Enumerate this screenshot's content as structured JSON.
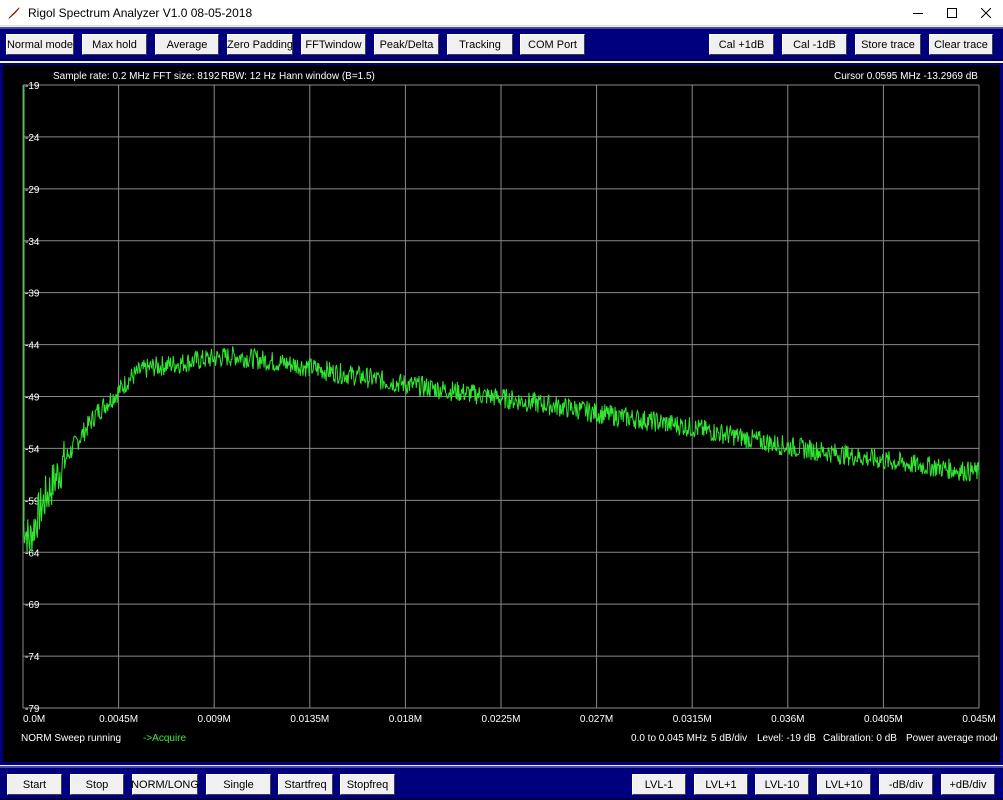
{
  "window": {
    "title": "Rigol Spectrum Analyzer V1.0 08-05-2018",
    "icon": "tk-feather-icon"
  },
  "top_toolbar": {
    "buttons": [
      {
        "label": "Normal mode",
        "name": "normal-mode-button"
      },
      {
        "label": "Max hold",
        "name": "max-hold-button"
      },
      {
        "label": "Average",
        "name": "average-button"
      },
      {
        "label": "Zero Padding",
        "name": "zero-padding-button"
      },
      {
        "label": "FFTwindow",
        "name": "fft-window-button"
      },
      {
        "label": "Peak/Delta",
        "name": "peak-delta-button"
      },
      {
        "label": "Tracking",
        "name": "tracking-button"
      },
      {
        "label": "COM Port",
        "name": "com-port-button"
      },
      {
        "label": "Cal +1dB",
        "name": "cal-plus-1db-button"
      },
      {
        "label": "Cal -1dB",
        "name": "cal-minus-1db-button"
      },
      {
        "label": "Store trace",
        "name": "store-trace-button"
      },
      {
        "label": "Clear trace",
        "name": "clear-trace-button"
      }
    ]
  },
  "bottom_toolbar": {
    "buttons": [
      {
        "label": "Start",
        "name": "start-button"
      },
      {
        "label": "Stop",
        "name": "stop-button"
      },
      {
        "label": "NORM/LONG",
        "name": "norm-long-button"
      },
      {
        "label": "Single",
        "name": "single-button"
      },
      {
        "label": "Startfreq",
        "name": "startfreq-button"
      },
      {
        "label": "Stopfreq",
        "name": "stopfreq-button"
      },
      {
        "label": "LVL-1",
        "name": "lvl-minus-1-button"
      },
      {
        "label": "LVL+1",
        "name": "lvl-plus-1-button"
      },
      {
        "label": "LVL-10",
        "name": "lvl-minus-10-button"
      },
      {
        "label": "LVL+10",
        "name": "lvl-plus-10-button"
      },
      {
        "label": "-dB/div",
        "name": "db-div-minus-button"
      },
      {
        "label": "+dB/div",
        "name": "db-div-plus-button"
      }
    ]
  },
  "plot": {
    "header": {
      "sample_rate": "Sample rate: 0.2 MHz",
      "fft_size": "FFT size: 8192",
      "rbw": "RBW: 12 Hz",
      "window": "Hann window (B=1.5)",
      "cursor": "Cursor 0.0595 MHz   -13.2969 dB"
    },
    "footer": {
      "status": "NORM Sweep running",
      "acquire": "->Acquire",
      "range": "0.0 to 0.045 MHz",
      "db_div": "5 dB/div",
      "level": "Level: -19 dB",
      "calibration": "Calibration: 0 dB",
      "mode": "Power average  mode"
    },
    "colors": {
      "background": "#000000",
      "grid": "#8a8a8a",
      "trace": "#32e632",
      "text": "#ffffff"
    }
  },
  "chart_data": {
    "type": "line",
    "title": "",
    "xlabel": "",
    "ylabel": "",
    "xlim": [
      0,
      0.045
    ],
    "ylim": [
      -79,
      -19
    ],
    "grid": true,
    "x_tick_labels": [
      "0.0M",
      "0.0045M",
      "0.009M",
      "0.0135M",
      "0.018M",
      "0.0225M",
      "0.027M",
      "0.0315M",
      "0.036M",
      "0.0405M",
      "0.045M"
    ],
    "y_tick_labels": [
      "-19",
      "-24",
      "-29",
      "-34",
      "-39",
      "-44",
      "-49",
      "-54",
      "-59",
      "-64",
      "-69",
      "-74",
      "-79"
    ],
    "series": [
      {
        "x": [
          0,
          0.0003,
          0.0006,
          0.001,
          0.0015,
          0.002,
          0.0025,
          0.003,
          0.0035,
          0.004,
          0.0045,
          0.005,
          0.0055,
          0.006,
          0.007,
          0.008,
          0.009,
          0.01,
          0.011,
          0.012,
          0.013,
          0.014,
          0.015,
          0.016,
          0.017,
          0.018,
          0.019,
          0.02,
          0.021,
          0.022,
          0.023,
          0.024,
          0.025,
          0.026,
          0.027,
          0.028,
          0.029,
          0.03,
          0.031,
          0.032,
          0.033,
          0.034,
          0.035,
          0.036,
          0.037,
          0.038,
          0.039,
          0.04,
          0.041,
          0.042,
          0.043,
          0.044,
          0.045
        ],
        "values": [
          -61,
          -63,
          -61,
          -59,
          -57,
          -55,
          -53.5,
          -52,
          -50.5,
          -49.5,
          -48.5,
          -47.3,
          -46.6,
          -46.2,
          -45.9,
          -45.6,
          -45.3,
          -45.1,
          -45.4,
          -45.7,
          -46,
          -46.4,
          -46.8,
          -47.1,
          -47.5,
          -47.8,
          -48.1,
          -48.4,
          -48.7,
          -49,
          -49.3,
          -49.6,
          -49.9,
          -50.2,
          -50.6,
          -50.9,
          -51.2,
          -51.5,
          -51.8,
          -52.2,
          -52.6,
          -53,
          -53.4,
          -53.8,
          -54.1,
          -54.4,
          -54.7,
          -55,
          -55.3,
          -55.6,
          -55.8,
          -56.1,
          -56.3
        ]
      }
    ]
  }
}
